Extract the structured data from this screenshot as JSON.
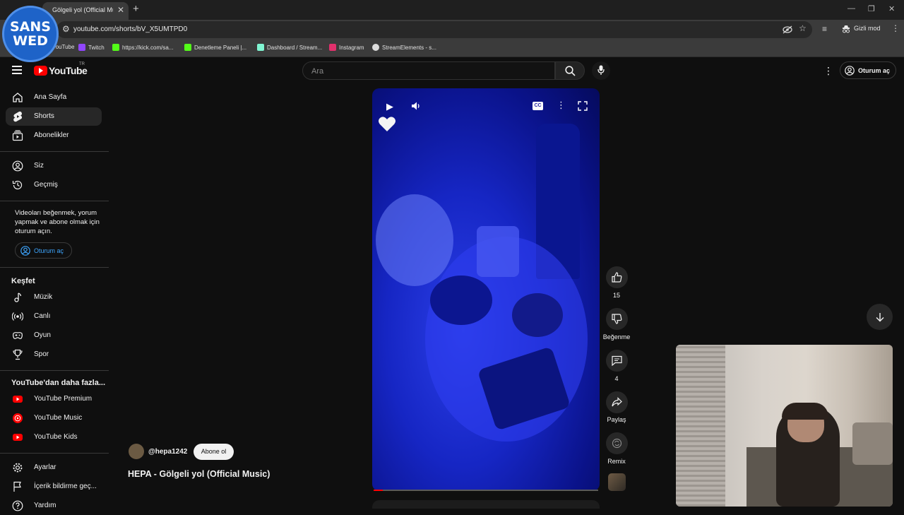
{
  "browser": {
    "tab_title": "Gölgeli yol (Official Mu:",
    "url": "youtube.com/shorts/bV_X5UMTPD0",
    "incognito_label": "Gizli mod",
    "bookmarks": [
      {
        "label": "YouTube",
        "icon": "youtube-icon",
        "color": "#ff0000"
      },
      {
        "label": "Twitch",
        "icon": "twitch-icon",
        "color": "#9146ff"
      },
      {
        "label": "https://kick.com/sa...",
        "icon": "kick-icon",
        "color": "#53fc18"
      },
      {
        "label": "Denetleme Paneli |...",
        "icon": "kick-icon",
        "color": "#53fc18"
      },
      {
        "label": "Dashboard / Stream...",
        "icon": "streamlabs-icon",
        "color": "#80f5d2"
      },
      {
        "label": "Instagram",
        "icon": "instagram-icon",
        "color": "#e1306c"
      },
      {
        "label": "StreamElements - s...",
        "icon": "streamelements-icon",
        "color": "#dddddd"
      }
    ]
  },
  "overlay_logo": {
    "line1": "SANS",
    "line2": "WED"
  },
  "header": {
    "logo_text": "YouTube",
    "region": "TR",
    "search_placeholder": "Ara",
    "signin_label": "Oturum aç"
  },
  "sidebar": {
    "primary": [
      {
        "label": "Ana Sayfa",
        "icon": "home-icon",
        "active": false
      },
      {
        "label": "Shorts",
        "icon": "shorts-icon",
        "active": true
      },
      {
        "label": "Abonelikler",
        "icon": "subscriptions-icon",
        "active": false
      }
    ],
    "you": [
      {
        "label": "Siz",
        "icon": "account-icon"
      },
      {
        "label": "Geçmiş",
        "icon": "history-icon"
      }
    ],
    "signin_prompt": "Videoları beğenmek, yorum yapmak ve abone olmak için oturum açın.",
    "signin_button": "Oturum aç",
    "explore_heading": "Keşfet",
    "explore": [
      {
        "label": "Müzik",
        "icon": "music-icon"
      },
      {
        "label": "Canlı",
        "icon": "live-icon"
      },
      {
        "label": "Oyun",
        "icon": "gaming-icon"
      },
      {
        "label": "Spor",
        "icon": "trophy-icon"
      }
    ],
    "more_heading": "YouTube'dan daha fazla...",
    "more": [
      {
        "label": "YouTube Premium",
        "icon": "youtube-premium-icon"
      },
      {
        "label": "YouTube Music",
        "icon": "youtube-music-icon"
      },
      {
        "label": "YouTube Kids",
        "icon": "youtube-kids-icon"
      }
    ],
    "footer": [
      {
        "label": "Ayarlar",
        "icon": "settings-icon"
      },
      {
        "label": "İçerik bildirme geç...",
        "icon": "flag-icon"
      },
      {
        "label": "Yardım",
        "icon": "help-icon"
      }
    ]
  },
  "short": {
    "channel": "@hepa1242",
    "subscribe_label": "Abone ol",
    "title": "HEPA - Gölgeli yol (Official Music)",
    "like_count": "15",
    "dislike_label": "Beğenme",
    "comment_count": "4",
    "share_label": "Paylaş",
    "remix_label": "Remix",
    "progress": 0.04
  }
}
